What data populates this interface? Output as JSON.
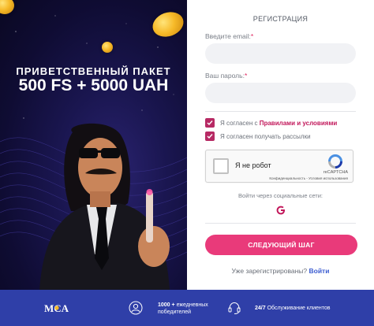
{
  "promo": {
    "title": "ПРИВЕТСТВЕННЫЙ ПАКЕТ",
    "bonus": "500 FS + 5000 UAH"
  },
  "form": {
    "title": "РЕГИСТРАЦИЯ",
    "email": {
      "label": "Введите email:",
      "required_mark": "*",
      "value": "",
      "placeholder": ""
    },
    "password": {
      "label": "Ваш пароль:",
      "required_mark": "*",
      "value": "",
      "placeholder": ""
    },
    "agree_terms": {
      "checked": true,
      "text": "Я согласен с ",
      "link": "Правилами и условиями"
    },
    "agree_newsletter": {
      "checked": true,
      "text": "Я согласен получать рассылки"
    },
    "captcha": {
      "label": "Я не робот",
      "brand": "reCAPTCHA",
      "links": "Конфиденциальность - Условия использования"
    },
    "social_label": "Войти через социальные сети:",
    "social_google": "G",
    "next_button": "СЛЕДУЮЩИЙ ШАГ",
    "login_prompt": "Уже зарегистрированы?",
    "login_link": "Войти"
  },
  "bottom_bar": {
    "logo": "MCA",
    "winners_count": "1000 +",
    "winners_text_1": "ежедневных",
    "winners_text_2": "победителей",
    "support_hours": "24/7",
    "support_text": "Обслуживание клиентов"
  },
  "colors": {
    "accent": "#e93a7a",
    "checkbox": "#b72a64",
    "link": "#3a5bd0",
    "bar": "#2f3fa8"
  },
  "icons": [
    "checkmark-icon",
    "recaptcha-icon",
    "google-icon",
    "person-icon",
    "headset-icon",
    "coin-icon"
  ]
}
